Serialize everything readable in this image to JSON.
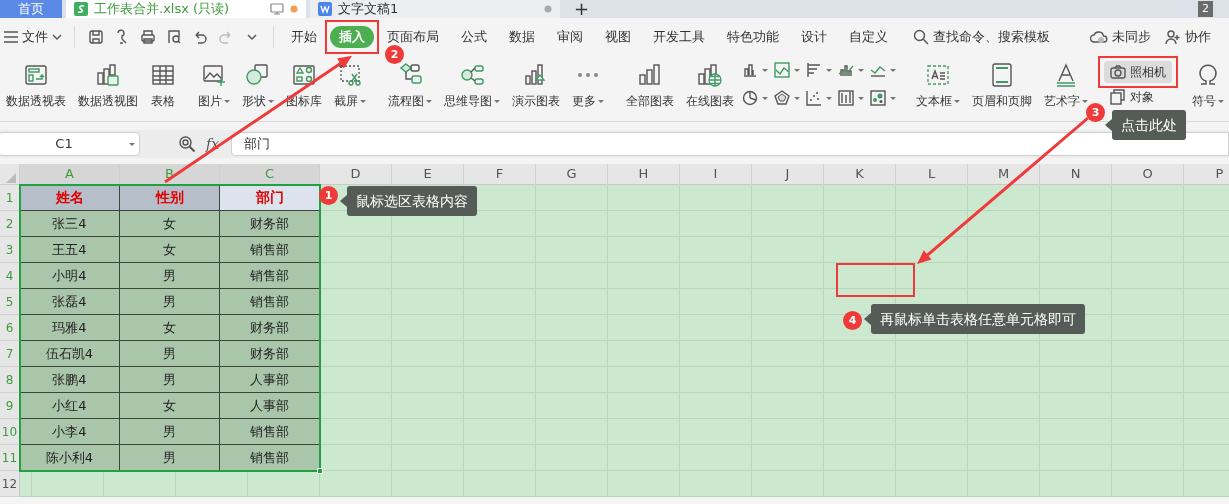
{
  "tabs": [
    {
      "label": "首页",
      "kind": "home",
      "selected": false
    },
    {
      "label": "工作表合并.xlsx (只读)",
      "kind": "sheet",
      "selected": true,
      "modified": true
    },
    {
      "label": "文字文稿1",
      "kind": "doc",
      "selected": false,
      "modified": false
    }
  ],
  "new_tab": "+",
  "window_badge": "2",
  "menu": {
    "file": "文件",
    "tabs": [
      {
        "label": "开始",
        "selected": false
      },
      {
        "label": "插入",
        "selected": true
      },
      {
        "label": "页面布局",
        "selected": false
      },
      {
        "label": "公式",
        "selected": false
      },
      {
        "label": "数据",
        "selected": false
      },
      {
        "label": "审阅",
        "selected": false
      },
      {
        "label": "视图",
        "selected": false
      },
      {
        "label": "开发工具",
        "selected": false
      },
      {
        "label": "特色功能",
        "selected": false
      },
      {
        "label": "设计",
        "selected": false
      },
      {
        "label": "自定义",
        "selected": false
      }
    ],
    "search": "查找命令、搜索模板",
    "sync": "未同步",
    "share": "协作"
  },
  "ribbon": {
    "groups": [
      {
        "items": [
          {
            "kind": "large",
            "label": "数据透视表",
            "dropdown": false
          },
          {
            "kind": "large",
            "label": "数据透视图",
            "dropdown": false
          },
          {
            "kind": "large",
            "label": "表格",
            "dropdown": false
          }
        ]
      },
      {
        "items": [
          {
            "kind": "large",
            "label": "图片",
            "dropdown": true
          },
          {
            "kind": "large",
            "label": "形状",
            "dropdown": true
          },
          {
            "kind": "large",
            "label": "图标库",
            "dropdown": false
          },
          {
            "kind": "large",
            "label": "截屏",
            "dropdown": true
          }
        ]
      },
      {
        "items": [
          {
            "kind": "large",
            "label": "流程图",
            "dropdown": true
          },
          {
            "kind": "large",
            "label": "思维导图",
            "dropdown": true
          },
          {
            "kind": "large",
            "label": "演示图表",
            "dropdown": false
          },
          {
            "kind": "large",
            "label": "更多",
            "dropdown": true
          }
        ]
      },
      {
        "items": [
          {
            "kind": "large",
            "label": "全部图表",
            "dropdown": false
          },
          {
            "kind": "large",
            "label": "在线图表",
            "dropdown": false
          },
          {
            "kind": "chart-grid"
          }
        ]
      },
      {
        "items": [
          {
            "kind": "large",
            "label": "文本框",
            "dropdown": true
          },
          {
            "kind": "large",
            "label": "页眉和页脚",
            "dropdown": false
          },
          {
            "kind": "large",
            "label": "艺术字",
            "dropdown": true
          },
          {
            "kind": "stack",
            "items": [
              {
                "label": "照相机",
                "selected": true
              },
              {
                "label": "对象",
                "selected": false
              }
            ]
          },
          {
            "kind": "large",
            "label": "符号",
            "dropdown": true
          }
        ]
      }
    ]
  },
  "formula_bar": {
    "name_box": "C1",
    "fx": "fx",
    "formula": "部门"
  },
  "sheet": {
    "columns": [
      {
        "label": "A",
        "selected": true
      },
      {
        "label": "B",
        "selected": true
      },
      {
        "label": "C",
        "selected": true
      },
      {
        "label": "D",
        "selected": false
      },
      {
        "label": "E",
        "selected": false
      },
      {
        "label": "F",
        "selected": false
      },
      {
        "label": "G",
        "selected": false
      },
      {
        "label": "H",
        "selected": false
      },
      {
        "label": "I",
        "selected": false
      },
      {
        "label": "J",
        "selected": false
      },
      {
        "label": "K",
        "selected": false
      },
      {
        "label": "L",
        "selected": false
      },
      {
        "label": "M",
        "selected": false
      },
      {
        "label": "N",
        "selected": false
      },
      {
        "label": "O",
        "selected": false
      },
      {
        "label": "P",
        "selected": false
      }
    ],
    "rows": [
      {
        "label": "1",
        "selected": true,
        "kind": "header",
        "cells": [
          {
            "text": "姓名",
            "active": false
          },
          {
            "text": "性别",
            "active": false
          },
          {
            "text": "部门",
            "active": true
          }
        ]
      },
      {
        "label": "2",
        "selected": true,
        "kind": "data",
        "cells": [
          {
            "text": "张三4"
          },
          {
            "text": "女"
          },
          {
            "text": "财务部"
          }
        ]
      },
      {
        "label": "3",
        "selected": true,
        "kind": "data",
        "cells": [
          {
            "text": "王五4"
          },
          {
            "text": "女"
          },
          {
            "text": "销售部"
          }
        ]
      },
      {
        "label": "4",
        "selected": true,
        "kind": "data",
        "cells": [
          {
            "text": "小明4"
          },
          {
            "text": "男"
          },
          {
            "text": "销售部"
          }
        ]
      },
      {
        "label": "5",
        "selected": true,
        "kind": "data",
        "cells": [
          {
            "text": "张磊4"
          },
          {
            "text": "男"
          },
          {
            "text": "销售部"
          }
        ]
      },
      {
        "label": "6",
        "selected": true,
        "kind": "data",
        "cells": [
          {
            "text": "玛雅4"
          },
          {
            "text": "女"
          },
          {
            "text": "财务部"
          }
        ]
      },
      {
        "label": "7",
        "selected": true,
        "kind": "data",
        "cells": [
          {
            "text": "伍石凯4"
          },
          {
            "text": "男"
          },
          {
            "text": "财务部"
          }
        ]
      },
      {
        "label": "8",
        "selected": true,
        "kind": "data",
        "cells": [
          {
            "text": "张鹏4"
          },
          {
            "text": "男"
          },
          {
            "text": "人事部"
          }
        ]
      },
      {
        "label": "9",
        "selected": true,
        "kind": "data",
        "cells": [
          {
            "text": "小红4"
          },
          {
            "text": "女"
          },
          {
            "text": "人事部"
          }
        ]
      },
      {
        "label": "10",
        "selected": true,
        "kind": "data",
        "cells": [
          {
            "text": "小李4"
          },
          {
            "text": "男"
          },
          {
            "text": "销售部"
          }
        ]
      },
      {
        "label": "11",
        "selected": true,
        "kind": "data",
        "cells": [
          {
            "text": "陈小利4"
          },
          {
            "text": "男"
          },
          {
            "text": "销售部"
          }
        ]
      },
      {
        "label": "12",
        "selected": false,
        "cells": []
      }
    ]
  },
  "steps": [
    {
      "number": "2"
    },
    {
      "number": "3",
      "text": "点击此处"
    },
    {
      "number": "1",
      "text": "鼠标选区表格内容"
    },
    {
      "number": "4",
      "text": "再鼠标单击表格任意单元格即可"
    }
  ]
}
